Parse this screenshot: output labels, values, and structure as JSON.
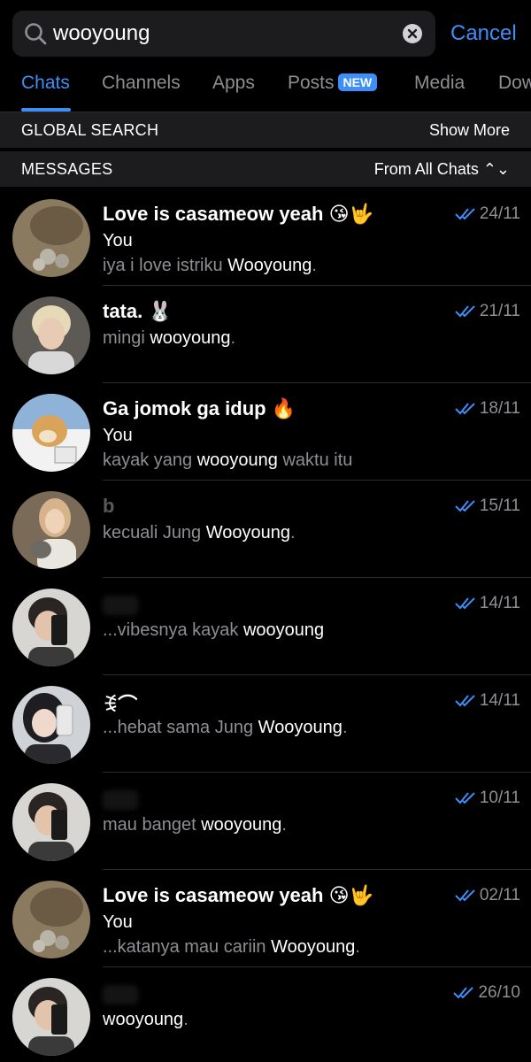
{
  "search": {
    "value": "wooyoung",
    "cancel_label": "Cancel"
  },
  "tabs": [
    {
      "label": "Chats",
      "active": true
    },
    {
      "label": "Channels"
    },
    {
      "label": "Apps"
    },
    {
      "label": "Posts",
      "badge": "NEW"
    },
    {
      "label": "Media"
    },
    {
      "label": "Dow"
    }
  ],
  "global_search": {
    "title": "GLOBAL SEARCH",
    "action": "Show More"
  },
  "messages_section": {
    "title": "MESSAGES",
    "filter": "From All Chats ⌃⌄"
  },
  "chats": [
    {
      "name": "Love is casameow yeah 😘🤟",
      "sender": "You",
      "preview_before": "iya i love istriku ",
      "preview_match": "Wooyoung",
      "preview_after": ".",
      "time": "24/11"
    },
    {
      "name": "tata. 🐰",
      "sender": "",
      "preview_before": "mingi ",
      "preview_match": "wooyoung",
      "preview_after": ".",
      "time": "21/11"
    },
    {
      "name": "Ga jomok ga idup 🔥",
      "sender": "You",
      "preview_before": "kayak yang ",
      "preview_match": "wooyoung",
      "preview_after": " waktu itu",
      "time": "18/11"
    },
    {
      "name": "b",
      "sender": "",
      "preview_before": "kecuali Jung ",
      "preview_match": "Wooyoung",
      "preview_after": ".",
      "time": "15/11"
    },
    {
      "name": "",
      "sender": "",
      "preview_before": "...vibesnya kayak ",
      "preview_match": "wooyoung",
      "preview_after": "",
      "time": "14/11"
    },
    {
      "name": "ꉂ⌒",
      "sender": "",
      "preview_before": "...hebat sama Jung ",
      "preview_match": "Wooyoung",
      "preview_after": ".",
      "time": "14/11"
    },
    {
      "name": "",
      "sender": "",
      "preview_before": "mau banget ",
      "preview_match": "wooyoung",
      "preview_after": ".",
      "time": "10/11"
    },
    {
      "name": "Love is casameow yeah 😘🤟",
      "sender": "You",
      "preview_before": "...katanya mau cariin ",
      "preview_match": "Wooyoung",
      "preview_after": ".",
      "time": "02/11"
    },
    {
      "name": "",
      "sender": "",
      "preview_before": "",
      "preview_match": "wooyoung",
      "preview_after": ".",
      "time": "26/10"
    }
  ],
  "colors": {
    "accent": "#3e8ef7",
    "background": "#000000",
    "header_bg": "#1c1c1e",
    "muted_text": "#8e8e93"
  },
  "icons": {
    "search": "search-icon",
    "clear": "clear-icon",
    "read_receipt": "double-check-icon"
  }
}
